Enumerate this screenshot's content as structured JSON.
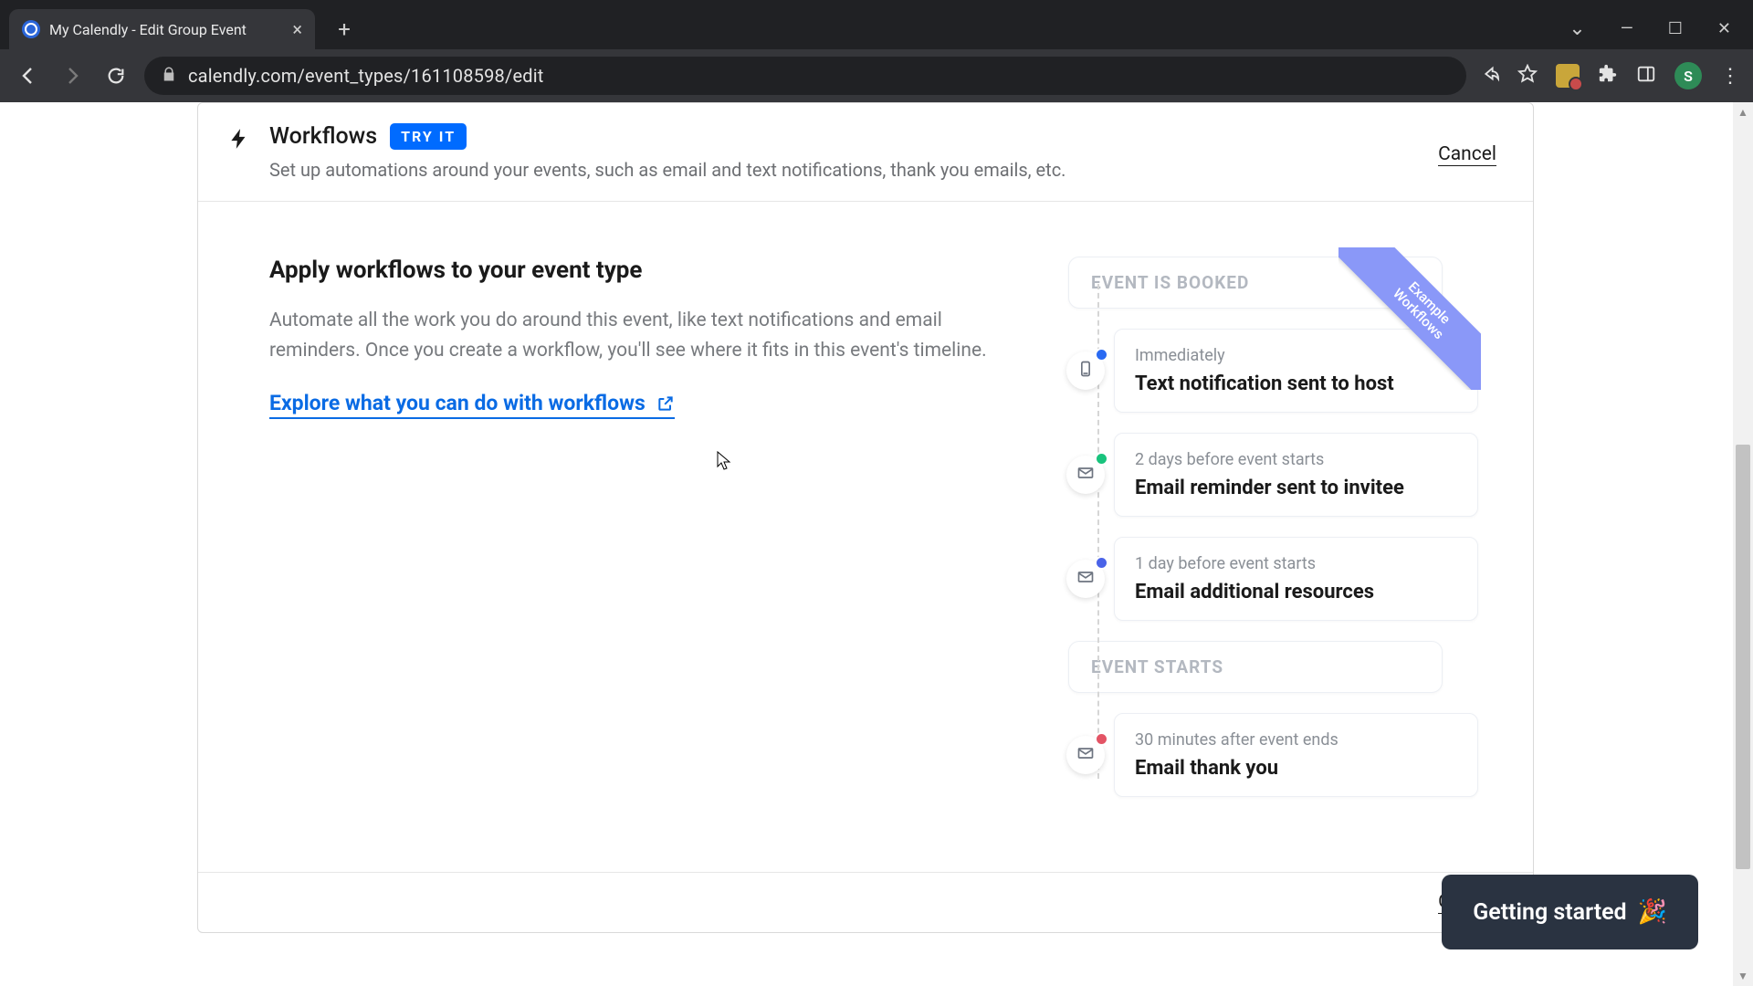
{
  "browser": {
    "tab_title": "My Calendly - Edit Group Event",
    "url": "calendly.com/event_types/161108598/edit",
    "avatar_initial": "S"
  },
  "header": {
    "title": "Workflows",
    "badge": "TRY IT",
    "subtitle": "Set up automations around your events, such as email and text notifications, thank you emails, etc.",
    "cancel": "Cancel"
  },
  "body": {
    "heading": "Apply workflows to your event type",
    "paragraph": "Automate all the work you do around this event, like text notifications and email reminders. Once you create a workflow, you'll see where it fits in this event's timeline.",
    "explore_link": "Explore what you can do with workflows"
  },
  "timeline": {
    "ribbon_line1": "Example",
    "ribbon_line2": "Workflows",
    "booked_label": "EVENT IS BOOKED",
    "starts_label": "EVENT STARTS",
    "items": [
      {
        "when": "Immediately",
        "what": "Text notification sent to host"
      },
      {
        "when": "2 days before event starts",
        "what": "Email reminder sent to invitee"
      },
      {
        "when": "1 day before event starts",
        "what": "Email additional resources"
      },
      {
        "when": "30 minutes after event ends",
        "what": "Email thank you"
      }
    ]
  },
  "footer": {
    "cancel": "Cancel"
  },
  "helper": {
    "label": "Getting started"
  }
}
